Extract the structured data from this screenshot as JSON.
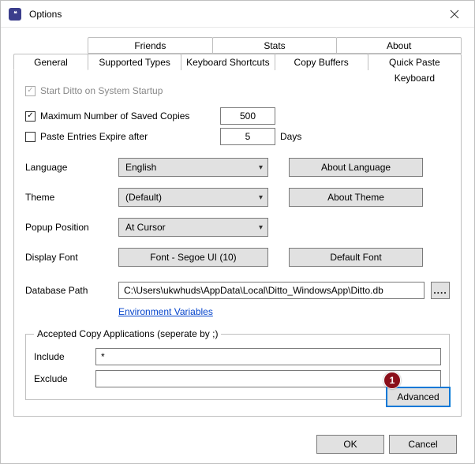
{
  "window": {
    "title": "Options"
  },
  "tabs": {
    "top": [
      "Friends",
      "Stats",
      "About"
    ],
    "bottom": [
      "General",
      "Supported Types",
      "Keyboard Shortcuts",
      "Copy Buffers",
      "Quick Paste Keyboard"
    ]
  },
  "general": {
    "startup_label": "Start Ditto on System Startup",
    "max_copies_label": "Maximum Number of Saved Copies",
    "max_copies_value": "500",
    "expire_label": "Paste Entries Expire after",
    "expire_value": "5",
    "expire_unit": "Days",
    "language_label": "Language",
    "language_value": "English",
    "about_language_btn": "About Language",
    "theme_label": "Theme",
    "theme_value": "(Default)",
    "about_theme_btn": "About Theme",
    "popup_label": "Popup Position",
    "popup_value": "At Cursor",
    "font_label": "Display Font",
    "font_btn": "Font - Segoe UI (10)",
    "default_font_btn": "Default Font",
    "db_label": "Database Path",
    "db_value": "C:\\Users\\ukwhuds\\AppData\\Local\\Ditto_WindowsApp\\Ditto.db",
    "browse_btn": "....",
    "env_vars_link": "Environment Variables",
    "accepted_legend": "Accepted Copy Applications (seperate by ;)",
    "include_label": "Include",
    "include_value": "*",
    "exclude_label": "Exclude",
    "exclude_value": "",
    "advanced_btn": "Advanced"
  },
  "footer": {
    "ok": "OK",
    "cancel": "Cancel"
  },
  "badge": "1"
}
